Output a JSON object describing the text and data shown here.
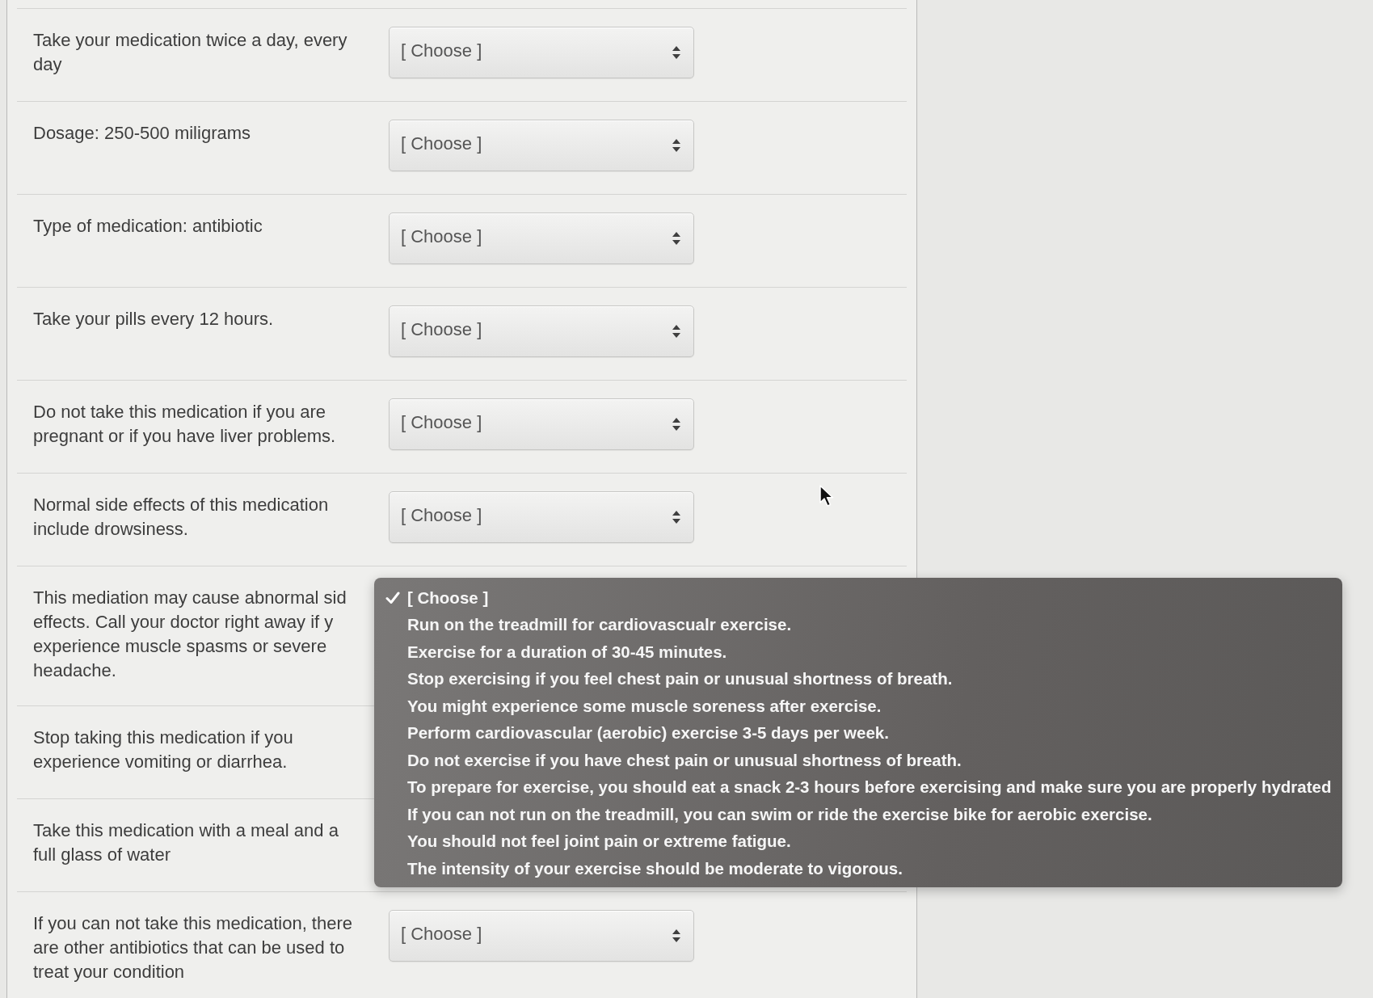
{
  "questions": [
    {
      "label": "Take your medication twice a day, every day",
      "select": {
        "value": "[ Choose ]"
      }
    },
    {
      "label": "Dosage: 250-500 miligrams",
      "select": {
        "value": "[ Choose ]"
      }
    },
    {
      "label": "Type of medication: antibiotic",
      "select": {
        "value": "[ Choose ]"
      }
    },
    {
      "label": "Take your pills every 12 hours.",
      "select": {
        "value": "[ Choose ]"
      }
    },
    {
      "label": "Do not take this medication if you are pregnant or if you have liver problems.",
      "select": {
        "value": "[ Choose ]"
      }
    },
    {
      "label": "Normal side effects of this medication include drowsiness.",
      "select": {
        "value": "[ Choose ]"
      }
    },
    {
      "label": "This mediation may cause abnormal sid effects. Call your doctor right away if y experience muscle spasms or severe headache.",
      "dropdown": {
        "options": [
          {
            "label": "[ Choose ]",
            "selected": true
          },
          {
            "label": "Run on the treadmill for cardiovascualr exercise.",
            "selected": false
          },
          {
            "label": "Exercise for a duration of 30-45 minutes.",
            "selected": false
          },
          {
            "label": "Stop exercising if you feel chest pain or unusual shortness of breath.",
            "selected": false
          },
          {
            "label": "You might experience some muscle soreness after exercise.",
            "selected": false
          },
          {
            "label": "Perform cardiovascular (aerobic) exercise 3-5 days per week.",
            "selected": false
          },
          {
            "label": "Do not exercise if you have chest pain or unusual shortness of breath.",
            "selected": false
          },
          {
            "label": "To prepare for exercise, you should eat a snack 2-3 hours before exercising and make sure you are properly hydrated",
            "selected": false
          },
          {
            "label": "If you can not run on the treadmill, you can swim or ride the exercise bike for aerobic exercise.",
            "selected": false
          },
          {
            "label": "You should not feel joint pain or extreme fatigue.",
            "selected": false
          },
          {
            "label": "The intensity of your exercise should be moderate to vigorous.",
            "selected": false
          }
        ]
      }
    },
    {
      "label": "Stop taking this medication if you experience vomiting or diarrhea."
    },
    {
      "label": "Take this medication with a meal and a full glass of water"
    },
    {
      "label": "If you can not take this medication, there are other antibiotics that can be used to treat your condition",
      "select": {
        "value": "[ Choose ]"
      }
    }
  ]
}
